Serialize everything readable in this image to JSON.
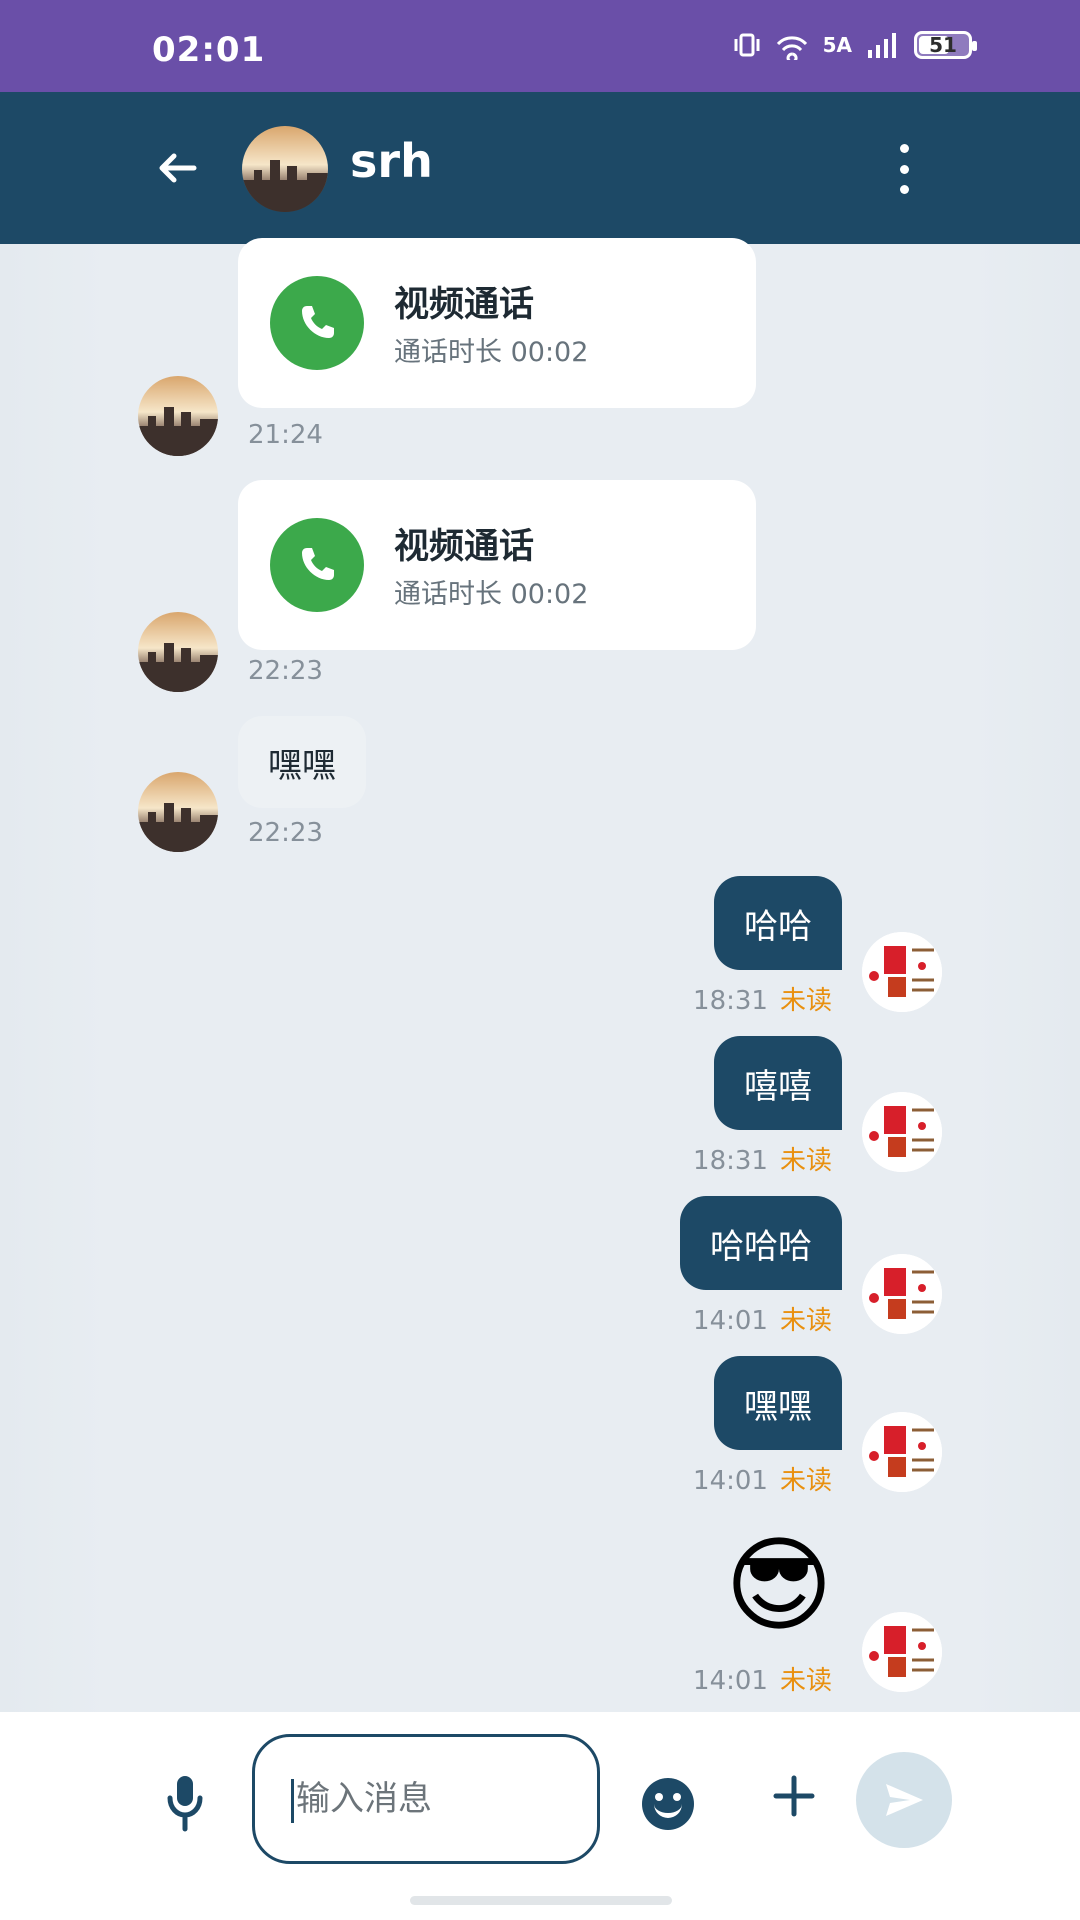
{
  "status": {
    "time": "02:01",
    "network": "5A",
    "battery": "51",
    "icons": [
      "vibrate-icon",
      "hotspot-icon",
      "signal-icon",
      "battery-icon"
    ]
  },
  "header": {
    "title": "srh"
  },
  "messages": {
    "call1": {
      "title": "视频通话",
      "sub": "通话时长 00:02",
      "time": "21:24"
    },
    "call2": {
      "title": "视频通话",
      "sub": "通话时长 00:02",
      "time": "22:23"
    },
    "in1": {
      "text": "嘿嘿",
      "time": "22:23"
    },
    "out1": {
      "text": "哈哈",
      "time": "18:31",
      "status": "未读"
    },
    "out2": {
      "text": "嘻嘻",
      "time": "18:31",
      "status": "未读"
    },
    "out3": {
      "text": "哈哈哈",
      "time": "14:01",
      "status": "未读"
    },
    "out4": {
      "text": "嘿嘿",
      "time": "14:01",
      "status": "未读"
    },
    "out5": {
      "emoji": "😎",
      "time": "14:01",
      "status": "未读"
    }
  },
  "input": {
    "placeholder": "输入消息"
  },
  "colors": {
    "appbar": "#1d4966",
    "status": "#6a4fa8",
    "accent": "#e9900f",
    "call": "#3ca94b"
  }
}
